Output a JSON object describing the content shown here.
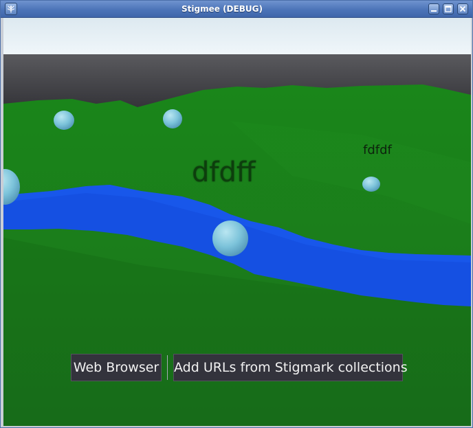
{
  "window": {
    "title": "Stigmee (DEBUG)",
    "controls": [
      "minimize-icon",
      "maximize-icon",
      "close-icon"
    ]
  },
  "scene": {
    "labels": [
      {
        "text": "dfdff"
      },
      {
        "text": "fdfdf"
      }
    ],
    "colors": {
      "sky": "#e9f3f9",
      "fog_band": "#3a3a3e",
      "grass": "#1a7a1a",
      "river": "#1650e0",
      "sphere": "#7fc6dd"
    }
  },
  "buttons": {
    "web_browser": "Web Browser",
    "add_urls": "Add URLs from Stigmark collections"
  }
}
